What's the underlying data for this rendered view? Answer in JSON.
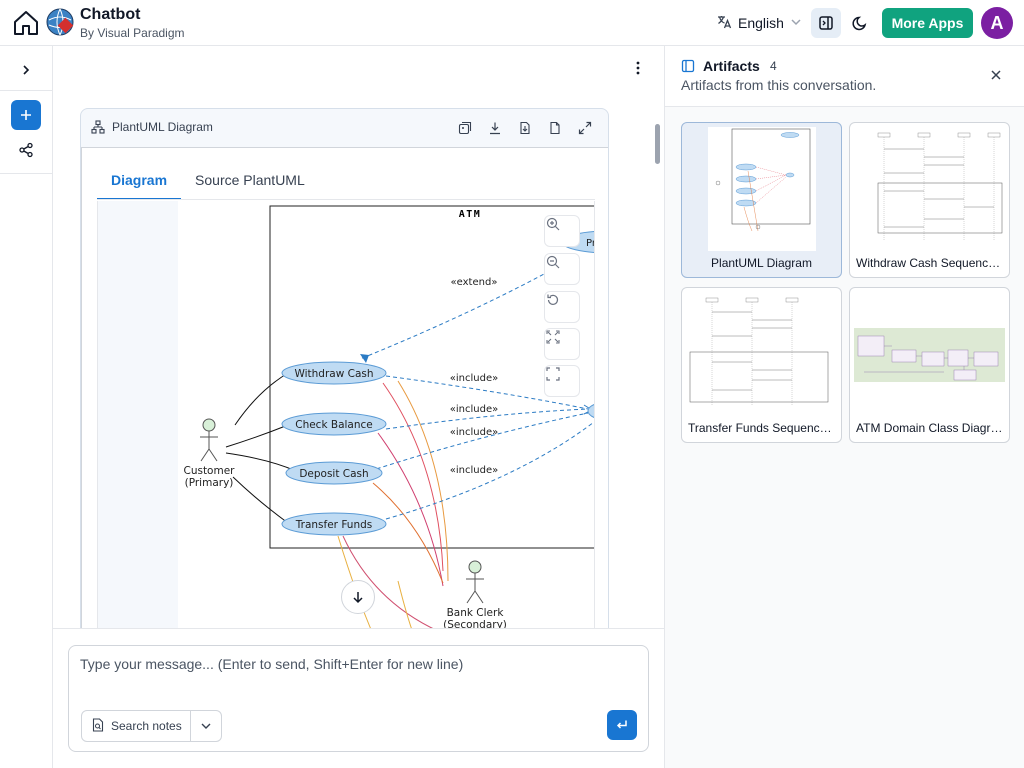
{
  "header": {
    "app_title": "Chatbot",
    "app_subtitle": "By Visual Paradigm",
    "language": "English",
    "more_apps": "More Apps",
    "avatar_letter": "A"
  },
  "card": {
    "title": "PlantUML Diagram",
    "tabs": [
      "Diagram",
      "Source PlantUML"
    ],
    "active_tab": "Diagram"
  },
  "diagram": {
    "system": "ATM",
    "use_cases": [
      "Withdraw Cash",
      "Check Balance",
      "Deposit Cash",
      "Transfer Funds"
    ],
    "partial_use_case": "Prin",
    "actor_primary": [
      "Customer",
      "(Primary)"
    ],
    "actor_secondary": [
      "Bank Clerk",
      "(Secondary)"
    ],
    "extend_label": "«extend»",
    "include_label": "«include»"
  },
  "composer": {
    "placeholder": "Type your message... (Enter to send, Shift+Enter for new line)",
    "search_notes": "Search notes"
  },
  "artifacts": {
    "title": "Artifacts",
    "count": "4",
    "subtitle": "Artifacts from this conversation.",
    "items": [
      {
        "label": "PlantUML Diagram"
      },
      {
        "label": "Withdraw Cash Sequence Diagram"
      },
      {
        "label": "Transfer Funds Sequence Diagram"
      },
      {
        "label": "ATM Domain Class Diagram"
      }
    ]
  },
  "colors": {
    "accent": "#1976d2",
    "more_apps": "#10a37f",
    "avatar": "#7b1fa2",
    "use_case_fill": "#bfdbf3",
    "use_case_stroke": "#5b9bd5"
  }
}
